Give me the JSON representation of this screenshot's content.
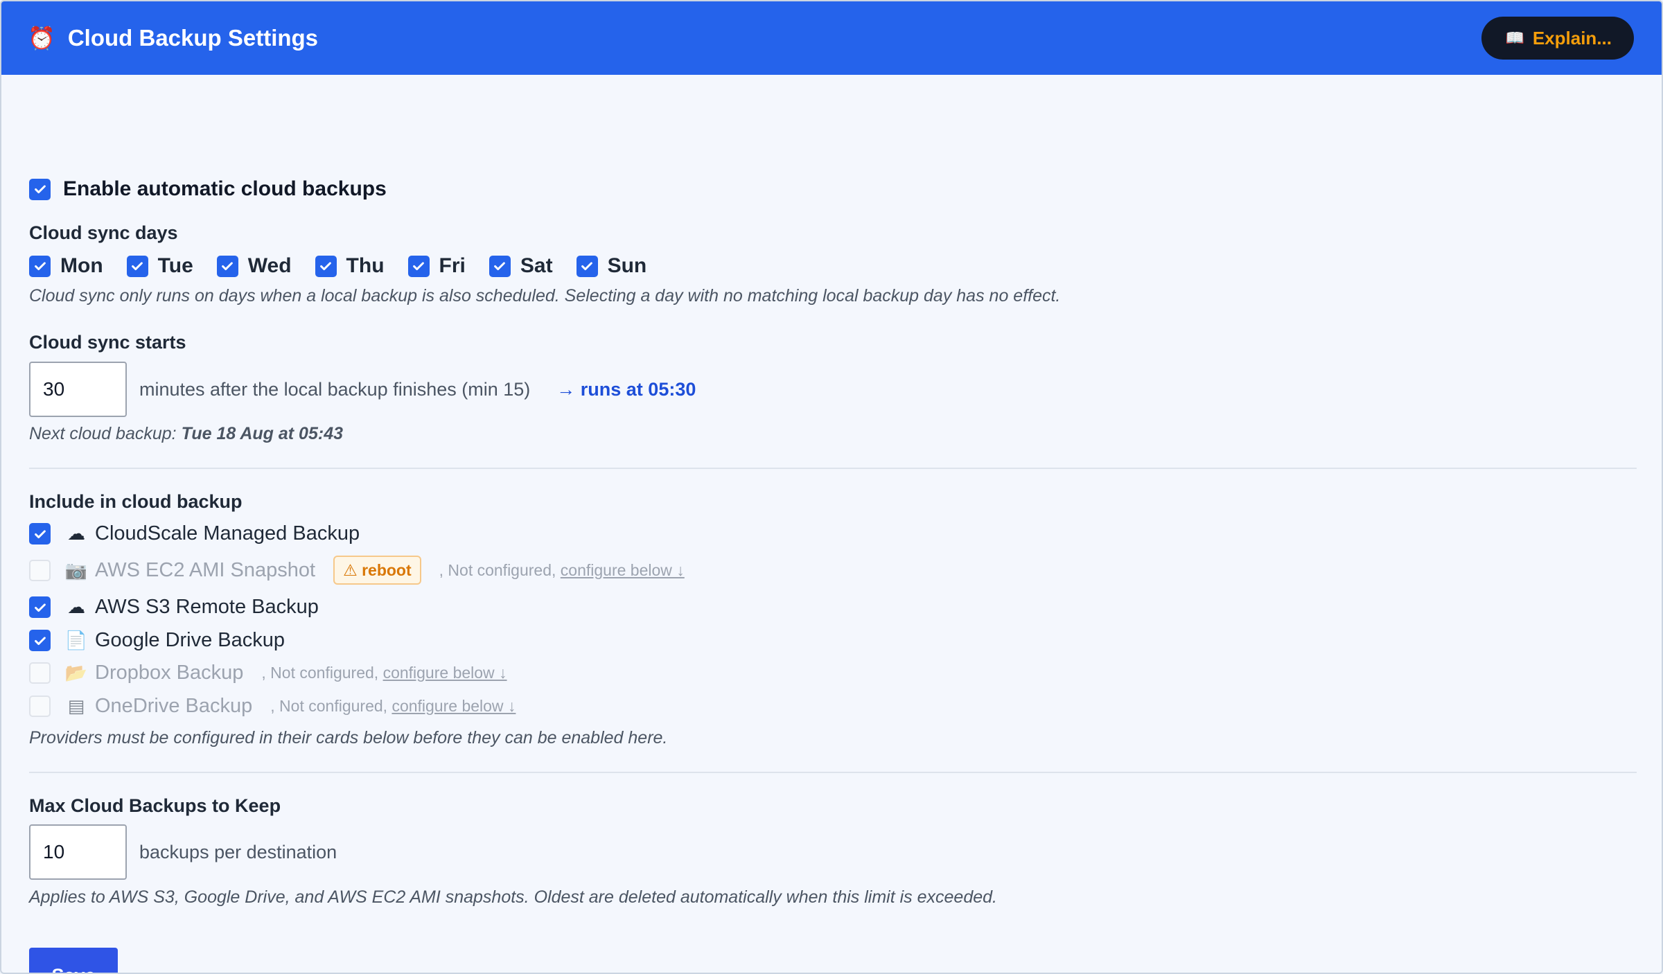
{
  "header": {
    "title": "Cloud Backup Settings",
    "explain_label": "Explain..."
  },
  "enable": {
    "label": "Enable automatic cloud backups",
    "checked": true
  },
  "sync_days": {
    "title": "Cloud sync days",
    "days": [
      {
        "label": "Mon",
        "checked": true
      },
      {
        "label": "Tue",
        "checked": true
      },
      {
        "label": "Wed",
        "checked": true
      },
      {
        "label": "Thu",
        "checked": true
      },
      {
        "label": "Fri",
        "checked": true
      },
      {
        "label": "Sat",
        "checked": true
      },
      {
        "label": "Sun",
        "checked": true
      }
    ],
    "hint": "Cloud sync only runs on days when a local backup is also scheduled. Selecting a day with no matching local backup day has no effect."
  },
  "sync_start": {
    "title": "Cloud sync starts",
    "value": "30",
    "suffix": "minutes after the local backup finishes (min 15)",
    "runs_at": "→ runs at 05:30",
    "next_prefix": "Next cloud backup:",
    "next_value": "Tue 18 Aug at 05:43"
  },
  "include": {
    "title": "Include in cloud backup",
    "providers": [
      {
        "label": "CloudScale Managed Backup",
        "icon": "☁",
        "checked": true,
        "disabled": false
      },
      {
        "label": "AWS EC2 AMI Snapshot",
        "icon": "📷",
        "checked": false,
        "disabled": true,
        "badge": "⚠ reboot",
        "note": ", Not configured,",
        "link": "configure below ↓"
      },
      {
        "label": "AWS S3 Remote Backup",
        "icon": "☁",
        "checked": true,
        "disabled": false
      },
      {
        "label": "Google Drive Backup",
        "icon": "📄",
        "checked": true,
        "disabled": false
      },
      {
        "label": "Dropbox Backup",
        "icon": "📂",
        "checked": false,
        "disabled": true,
        "note": ", Not configured,",
        "link": "configure below ↓"
      },
      {
        "label": "OneDrive Backup",
        "icon": "▤",
        "checked": false,
        "disabled": true,
        "note": ", Not configured,",
        "link": "configure below ↓"
      }
    ],
    "hint": "Providers must be configured in their cards below before they can be enabled here."
  },
  "max_keep": {
    "title": "Max Cloud Backups to Keep",
    "value": "10",
    "suffix": "backups per destination",
    "hint": "Applies to AWS S3, Google Drive, and AWS EC2 AMI snapshots. Oldest are deleted automatically when this limit is exceeded."
  },
  "save_label": "Save",
  "colors": {
    "accent": "#2563eb",
    "header_bg": "#2563eb",
    "explain_bg": "#111827",
    "explain_text": "#f59e0b",
    "runs_at": "#1d4ed8",
    "badge": "#d97706"
  }
}
